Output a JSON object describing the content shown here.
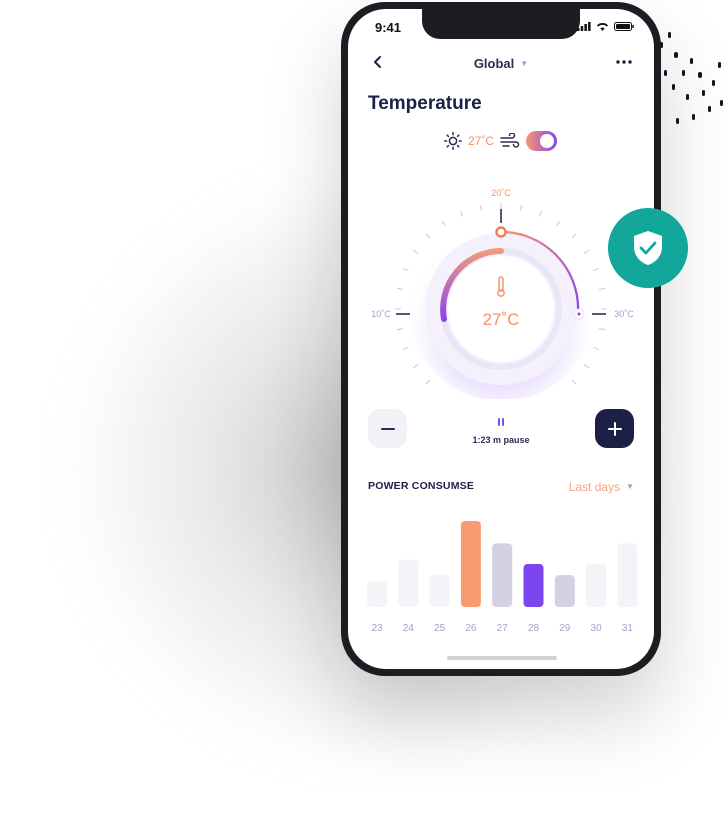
{
  "status_bar": {
    "time": "9:41"
  },
  "nav": {
    "title": "Global"
  },
  "page_title": "Temperature",
  "status_row": {
    "temperature": "27˚C",
    "weather_icon": "sun-icon",
    "wind_icon": "wind-icon",
    "toggle_on": true
  },
  "dial": {
    "center_value": "27˚C",
    "top_label": "20˚C",
    "left_label": "10˚C",
    "right_label": "30˚C",
    "icon": "thermometer-icon"
  },
  "controls": {
    "minus_icon": "minus-icon",
    "plus_icon": "plus-icon",
    "pause_label": "1:23 m pause"
  },
  "power": {
    "title": "POWER CONSUMSE",
    "filter_label": "Last days",
    "bars": [
      {
        "day": "23",
        "value": 0.3,
        "color": "#f3f3f8"
      },
      {
        "day": "24",
        "value": 0.55,
        "color": "#f3f3f8"
      },
      {
        "day": "25",
        "value": 0.37,
        "color": "#f3f3f8"
      },
      {
        "day": "26",
        "value": 1.0,
        "color": "#f99a72"
      },
      {
        "day": "27",
        "value": 0.74,
        "color": "#d4d1e2"
      },
      {
        "day": "28",
        "value": 0.5,
        "color": "#7b45f0"
      },
      {
        "day": "29",
        "value": 0.37,
        "color": "#d4d1e2"
      },
      {
        "day": "30",
        "value": 0.5,
        "color": "#f3f3f8"
      },
      {
        "day": "31",
        "value": 0.74,
        "color": "#f3f3f8"
      }
    ]
  },
  "badge": {
    "icon": "shield-check-icon",
    "color": "#13a79b"
  },
  "colors": {
    "accent_orange": "#f7966c",
    "accent_purple": "#8a45f0",
    "navy": "#1d2046"
  }
}
